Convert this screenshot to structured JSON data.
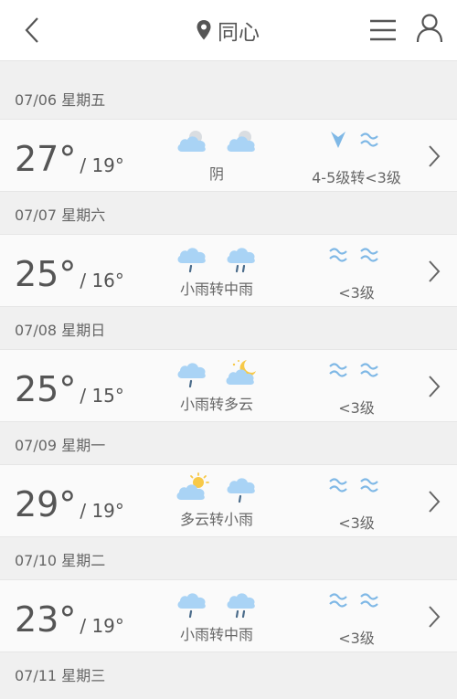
{
  "header": {
    "location": "同心"
  },
  "days": [
    {
      "date": "07/06 星期五",
      "high": "27°",
      "low": "/ 19°",
      "icons": [
        "cloudy-icon",
        "cloudy-icon"
      ],
      "weather": "阴",
      "wind_icons": [
        "wind-direction-icon",
        "wind-wave-icon"
      ],
      "wind": "4-5级转<3级"
    },
    {
      "date": "07/07 星期六",
      "high": "25°",
      "low": "/ 16°",
      "icons": [
        "light-rain-icon",
        "light-rain-icon"
      ],
      "weather": "小雨转中雨",
      "wind_icons": [
        "wind-wave-icon",
        "wind-wave-icon"
      ],
      "wind": "<3级"
    },
    {
      "date": "07/08 星期日",
      "high": "25°",
      "low": "/ 15°",
      "icons": [
        "light-rain-icon",
        "partly-cloudy-night-icon"
      ],
      "weather": "小雨转多云",
      "wind_icons": [
        "wind-wave-icon",
        "wind-wave-icon"
      ],
      "wind": "<3级"
    },
    {
      "date": "07/09 星期一",
      "high": "29°",
      "low": "/ 19°",
      "icons": [
        "partly-cloudy-day-icon",
        "light-rain-icon"
      ],
      "weather": "多云转小雨",
      "wind_icons": [
        "wind-wave-icon",
        "wind-wave-icon"
      ],
      "wind": "<3级"
    },
    {
      "date": "07/10 星期二",
      "high": "23°",
      "low": "/ 19°",
      "icons": [
        "light-rain-icon",
        "light-rain-icon"
      ],
      "weather": "小雨转中雨",
      "wind_icons": [
        "wind-wave-icon",
        "wind-wave-icon"
      ],
      "wind": "<3级"
    }
  ],
  "next_day": {
    "date": "07/11 星期三"
  },
  "colors": {
    "accent": "#7fb8e6",
    "cloud": "#a9d3f5",
    "sun": "#f7c948",
    "text": "#555555"
  }
}
